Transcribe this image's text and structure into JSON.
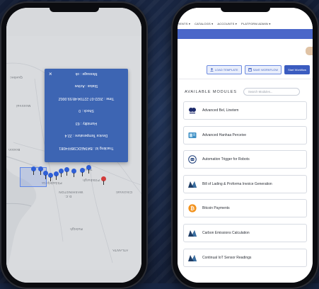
{
  "map": {
    "popup": {
      "close_glyph": "×",
      "rows": [
        "Tracking Id : BATAEDC98FF4081",
        "Device Temperature : 22.4",
        "Humidity : 63",
        "Shock : 0",
        "Time : 2022-07-22T04:48:59.000Z",
        "Status : Active",
        "Message : ok"
      ]
    },
    "labels": {
      "quebec": "Quebec",
      "montreal": "Montreal",
      "boston": "Boston",
      "toronto": "Toronto",
      "pittsburgh": "Pittsburgh",
      "philadelphia": "Philadelphia",
      "washington": "WASHINGTON",
      "dc": "D.C.",
      "cincinnati": "Cincinnati",
      "raleigh": "Raleigh",
      "atlanta": "ATLANTA"
    },
    "pin_colors": {
      "primary": "#2f5fd6",
      "alert": "#d23b3b"
    }
  },
  "app": {
    "nav": [
      "RENTS ▾",
      "CATALOGS ▾",
      "ACCOUNTS ▾",
      "PLATFORM ADMIN ▾"
    ],
    "toolbar": {
      "load_template": "LOAD TEMPLATE",
      "save_workflow": "SAVE WORKFLOW",
      "start_workflow": "Start Workflow"
    },
    "modules": {
      "title": "AVAILABLE MODULES",
      "search_placeholder": "Search Modules...",
      "items": [
        {
          "label": "Advanced Bel, Linetem",
          "icon": "bel-logo-icon"
        },
        {
          "label": "Advanced Hanhaa Perceive",
          "icon": "device-icon"
        },
        {
          "label": "Automation Trigger for Robots",
          "icon": "robot-icon"
        },
        {
          "label": "Bill of Lading & Proforma Invoice Generation",
          "icon": "mountain-logo-icon"
        },
        {
          "label": "Bitcoin Payments",
          "icon": "bitcoin-icon"
        },
        {
          "label": "Carbon Emissions Calculation",
          "icon": "mountain-logo-icon"
        },
        {
          "label": "Continual IoT Sensor Readings",
          "icon": "mountain-logo-icon"
        }
      ]
    },
    "colors": {
      "accent": "#3b5cc0",
      "band": "#4a67c9"
    }
  }
}
